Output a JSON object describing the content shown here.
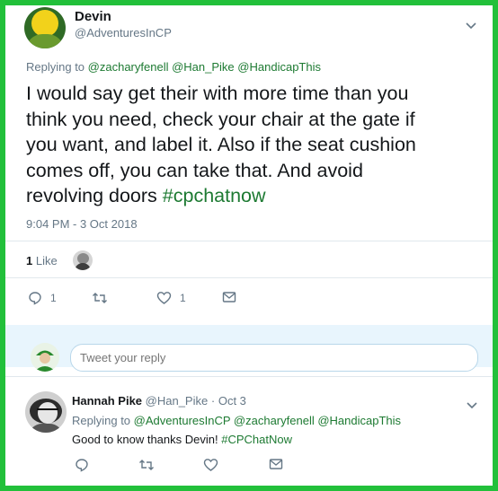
{
  "tweet": {
    "author_name": "Devin",
    "author_handle": "@AdventuresInCP",
    "replying_prefix": "Replying to",
    "replying_to": [
      "@zacharyfenell",
      "@Han_Pike",
      "@HandicapThis"
    ],
    "text_lines": [
      "I would say get their with more time than you",
      "think you need, check your chair at the gate if",
      "you want, and label it. Also if the seat cushion",
      "comes off, you can take that. And avoid"
    ],
    "text_last_plain": "revolving doors",
    "hashtag": "#cpchatnow",
    "timestamp": "9:04 PM - 3 Oct 2018",
    "like_count": "1",
    "like_label": "Like",
    "actions": {
      "reply_count": "1",
      "retweet_count": "",
      "like_count": "1"
    }
  },
  "reply_box": {
    "placeholder": "Tweet your reply"
  },
  "reply": {
    "author_name": "Hannah Pike",
    "author_handle": "@Han_Pike",
    "separator": "·",
    "date": "Oct 3",
    "replying_prefix": "Replying to",
    "replying_to": [
      "@AdventuresInCP",
      "@zacharyfenell",
      "@HandicapThis"
    ],
    "text_plain": "Good to know thanks Devin!",
    "hashtag": "#CPChatNow"
  },
  "colors": {
    "frame_border": "#22c03a",
    "link": "#1d7a32",
    "muted": "#657786",
    "reply_bar": "#e8f5fd"
  }
}
